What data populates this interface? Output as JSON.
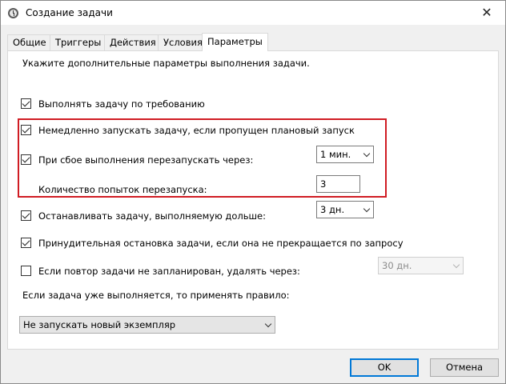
{
  "window": {
    "title": "Создание задачи",
    "close_glyph": "✕"
  },
  "tabs": [
    {
      "label": "Общие"
    },
    {
      "label": "Триггеры"
    },
    {
      "label": "Действия"
    },
    {
      "label": "Условия"
    },
    {
      "label": "Параметры",
      "active": true
    }
  ],
  "settings": {
    "intro": "Укажите дополнительные параметры выполнения задачи.",
    "run_on_demand": {
      "label": "Выполнять задачу по требованию",
      "checked": true
    },
    "run_missed": {
      "label": "Немедленно запускать задачу, если пропущен плановый запуск",
      "checked": true
    },
    "restart_on_fail": {
      "label": "При сбое выполнения перезапускать через:",
      "checked": true,
      "value": "1 мин."
    },
    "restart_attempts": {
      "label": "Количество попыток перезапуска:",
      "value": "3"
    },
    "stop_long": {
      "label": "Останавливать задачу, выполняемую дольше:",
      "checked": true,
      "value": "3 дн."
    },
    "force_stop": {
      "label": "Принудительная остановка задачи, если она не прекращается по запросу",
      "checked": true
    },
    "delete_if_not_scheduled": {
      "label": "Если повтор задачи не запланирован, удалять через:",
      "checked": false,
      "value": "30 дн."
    },
    "running_rule_label": "Если задача уже выполняется, то применять правило:",
    "running_rule_value": "Не запускать новый экземпляр"
  },
  "footer": {
    "ok": "OK",
    "cancel": "Отмена"
  },
  "colors": {
    "highlight_border": "#d01c23",
    "primary_button_border": "#0078d7"
  }
}
